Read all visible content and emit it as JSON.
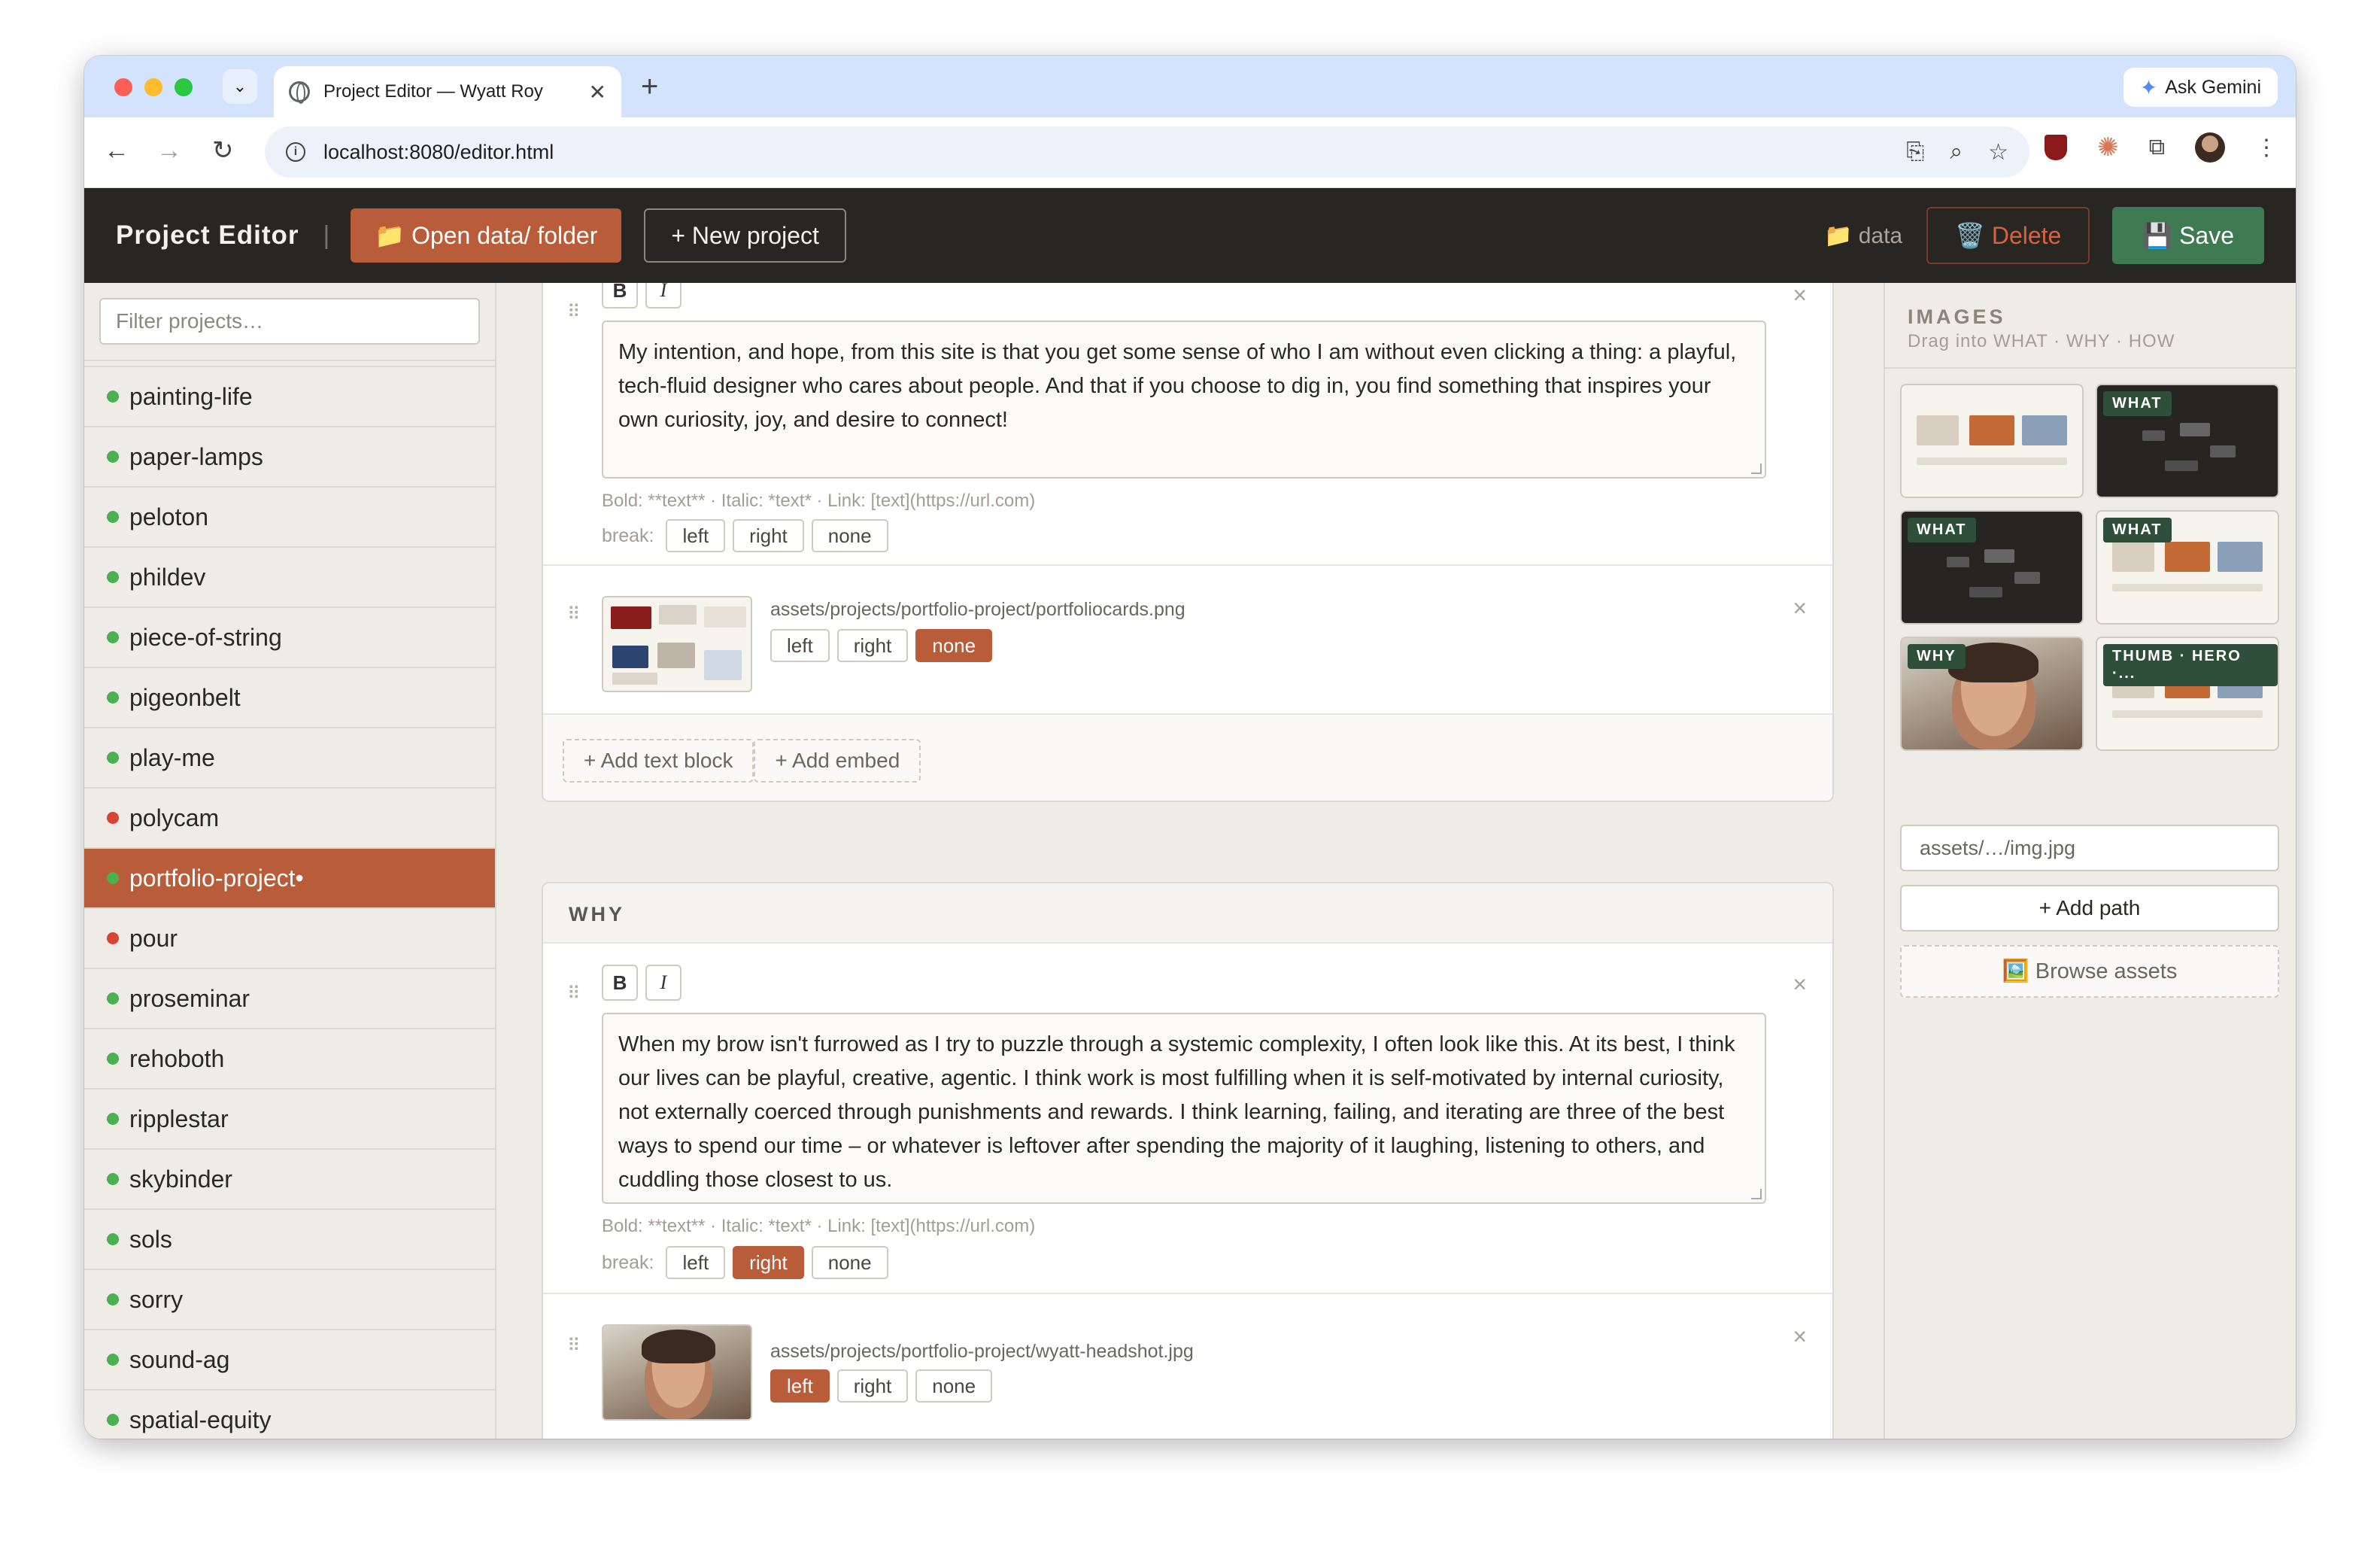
{
  "browser": {
    "tab_title": "Project Editor — Wyatt Roy",
    "url": "localhost:8080/editor.html",
    "ask_gemini": "Ask Gemini"
  },
  "header": {
    "title": "Project Editor",
    "open_folder": "📁 Open data/ folder",
    "new_project": "+ New project",
    "data_label": "📁 data",
    "delete": "🗑️ Delete",
    "save": "💾 Save"
  },
  "sidebar": {
    "filter_placeholder": "Filter projects…",
    "items": [
      {
        "name": "painting-life",
        "status": "green"
      },
      {
        "name": "paper-lamps",
        "status": "green"
      },
      {
        "name": "peloton",
        "status": "green"
      },
      {
        "name": "phildev",
        "status": "green"
      },
      {
        "name": "piece-of-string",
        "status": "green"
      },
      {
        "name": "pigeonbelt",
        "status": "green"
      },
      {
        "name": "play-me",
        "status": "green"
      },
      {
        "name": "polycam",
        "status": "red"
      },
      {
        "name": "portfolio-project•",
        "status": "green",
        "active": true
      },
      {
        "name": "pour",
        "status": "red"
      },
      {
        "name": "proseminar",
        "status": "green"
      },
      {
        "name": "rehoboth",
        "status": "green"
      },
      {
        "name": "ripplestar",
        "status": "green"
      },
      {
        "name": "skybinder",
        "status": "green"
      },
      {
        "name": "sols",
        "status": "green"
      },
      {
        "name": "sorry",
        "status": "green"
      },
      {
        "name": "sound-ag",
        "status": "green"
      },
      {
        "name": "spatial-equity",
        "status": "green"
      }
    ],
    "status_colors": {
      "green": "#4caf50",
      "red": "#d64534"
    }
  },
  "editor": {
    "bold": "B",
    "italic": "I",
    "format_hint": "Bold: **text** · Italic: *text* · Link: [text](https://url.com)",
    "break_label": "break:",
    "break_options": [
      "left",
      "right",
      "none"
    ],
    "what": {
      "text_block": {
        "text": "My intention, and hope, from this site is that you get some sense of who I am without even clicking a thing: a playful, tech-fluid designer who cares about people. And that if you choose to dig in, you find something that inspires your own curiosity, joy, and desire to connect!",
        "break": "none-selected"
      },
      "image_block": {
        "path": "assets/projects/portfolio-project/portfoliocards.png",
        "break": "none"
      },
      "add_text": "+ Add text block",
      "add_embed": "+ Add embed"
    },
    "why": {
      "title": "WHY",
      "text_block": {
        "text": "When my brow isn't furrowed as I try to puzzle through a systemic complexity, I often look like this. At its best, I think our lives can be playful, creative, agentic. I think work is most fulfilling when it is self-motivated by internal curiosity, not externally coerced through punishments and rewards. I think learning, failing, and iterating are three of the best ways to spend our time – or whatever is leftover after spending the majority of it laughing, listening to others, and cuddling those closest to us.",
        "break": "right"
      },
      "image_block": {
        "path": "assets/projects/portfolio-project/wyatt-headshot.jpg",
        "break": "left"
      }
    },
    "accent": "#b95c3a"
  },
  "images_panel": {
    "title": "IMAGES",
    "subtitle": "Drag into WHAT · WHY · HOW",
    "tiles": [
      {
        "tag": "",
        "style": "light"
      },
      {
        "tag": "WHAT",
        "style": "dark"
      },
      {
        "tag": "WHAT",
        "style": "dark"
      },
      {
        "tag": "WHAT",
        "style": "light"
      },
      {
        "tag": "WHY",
        "style": "face"
      },
      {
        "tag": "THUMB · HERO ·...",
        "style": "light"
      }
    ],
    "path_placeholder": "assets/…/img.jpg",
    "add_path": "+ Add path",
    "browse": "🖼️ Browse assets"
  }
}
